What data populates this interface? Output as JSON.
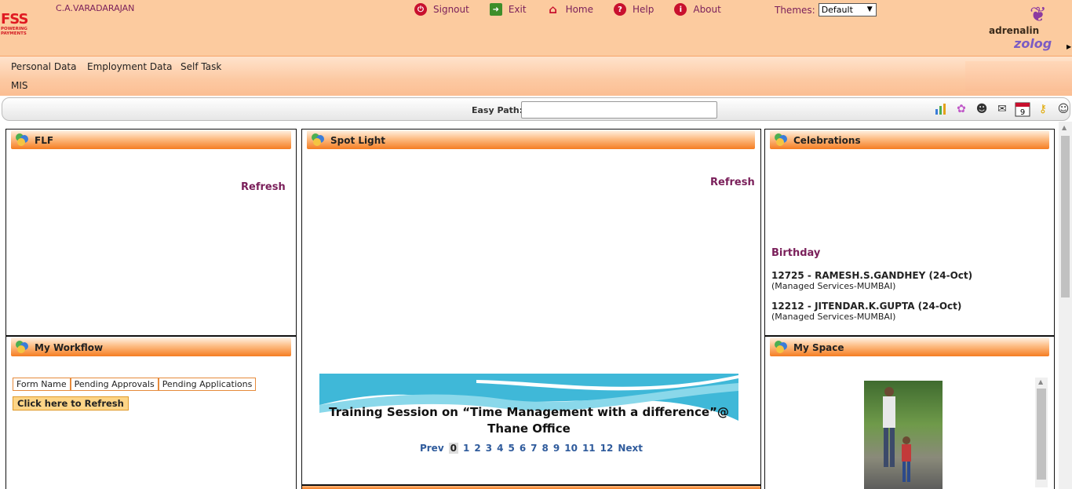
{
  "header": {
    "logo_text": "FSS",
    "logo_sub1": "POWERING",
    "logo_sub2": "PAYMENTS",
    "user_name": "C.A.VARADARAJAN",
    "nav": [
      {
        "label": "Signout",
        "icon": "power-icon"
      },
      {
        "label": "Exit",
        "icon": "exit-door-icon"
      },
      {
        "label": "Home",
        "icon": "home-icon"
      },
      {
        "label": "Help",
        "icon": "help-icon"
      },
      {
        "label": "About",
        "icon": "info-icon"
      }
    ],
    "themes_label": "Themes:",
    "themes_value": "Default",
    "brand_top": "adrenalin",
    "brand_bottom": "zolog"
  },
  "menu": {
    "items": [
      "Personal Data",
      "Employment Data",
      "Self Task",
      "MIS"
    ]
  },
  "path_bar": {
    "label": "Easy Path:",
    "value": "",
    "tools": [
      "chart-icon",
      "gear-icon",
      "people-icon",
      "mail-icon",
      "calendar-icon",
      "key-icon",
      "user-icon"
    ],
    "calendar_day": "9"
  },
  "panels": {
    "flf": {
      "title": "FLF",
      "refresh": "Refresh"
    },
    "spotlight": {
      "title": "Spot Light",
      "refresh": "Refresh",
      "banner_line1": "Training Session on “Time Management with a difference”@",
      "banner_line2": "Thane Office",
      "pager": {
        "prev": "Prev",
        "pages": [
          "0",
          "1",
          "2",
          "3",
          "4",
          "5",
          "6",
          "7",
          "8",
          "9",
          "10",
          "11",
          "12"
        ],
        "current": "0",
        "next": "Next"
      }
    },
    "celebrations": {
      "title": "Celebrations",
      "section": "Birthday",
      "entries": [
        {
          "name": "12725 - RAMESH.S.GANDHEY (24-Oct)",
          "dept": "(Managed Services-MUMBAI)"
        },
        {
          "name": "12212 - JITENDAR.K.GUPTA (24-Oct)",
          "dept": "(Managed Services-MUMBAI)"
        }
      ]
    },
    "workflow": {
      "title": "My Workflow",
      "columns": [
        "Form Name",
        "Pending Approvals",
        "Pending Applications"
      ],
      "button": "Click here to Refresh"
    },
    "myspace": {
      "title": "My Space"
    }
  },
  "colors": {
    "header_bg": "#fccb9f",
    "accent_text": "#7a1f5a",
    "title_bar_orange": "#f57d22",
    "pager_blue": "#2f5b9c"
  }
}
